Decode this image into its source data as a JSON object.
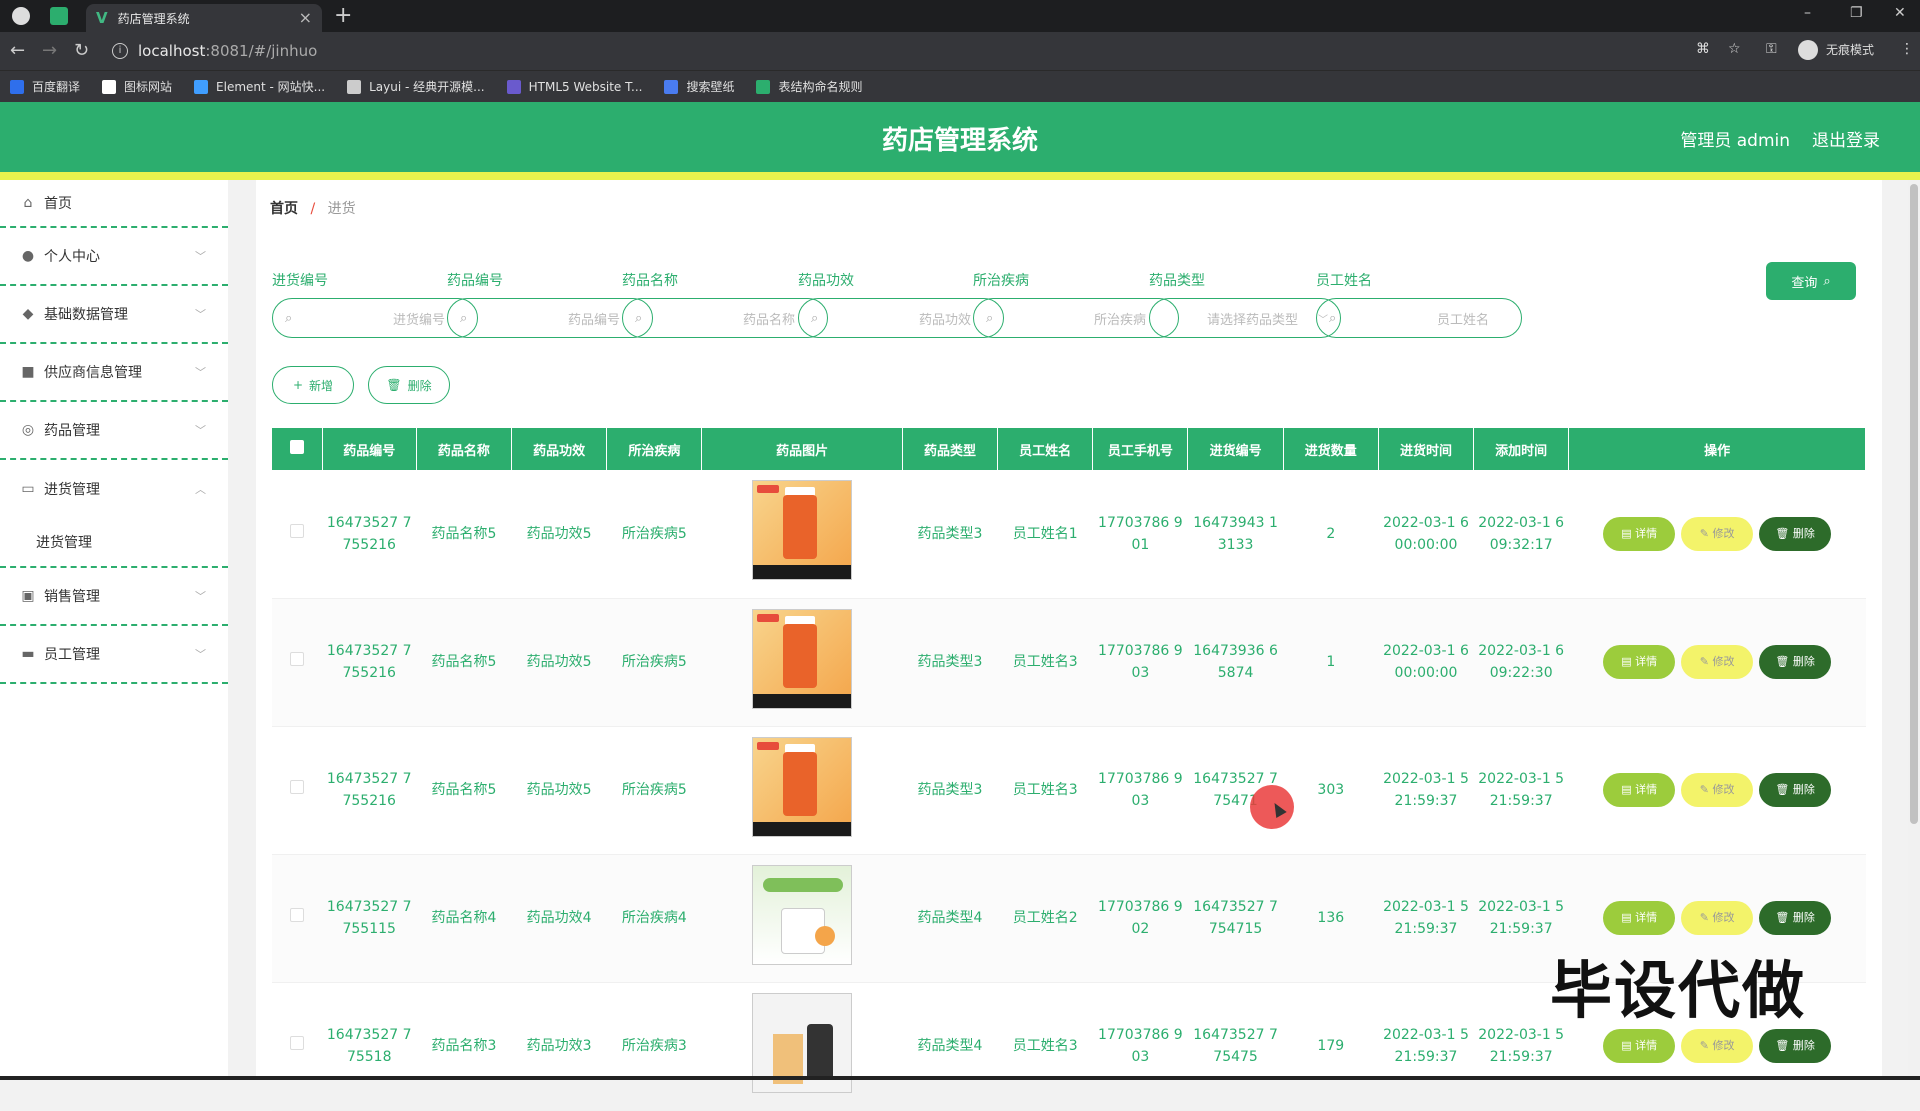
{
  "browser": {
    "tab_title": "药店管理系统",
    "url_host": "localhost",
    "url_rest": ":8081/#/jinhuo",
    "incognito_label": "无痕模式",
    "bookmarks": [
      {
        "label": "百度翻译",
        "color": "#2f6fec"
      },
      {
        "label": "图标网站",
        "color": "#ffffff"
      },
      {
        "label": "Element - 网站快...",
        "color": "#409eff"
      },
      {
        "label": "Layui - 经典开源模...",
        "color": "#cccccc"
      },
      {
        "label": "HTML5 Website T...",
        "color": "#6a5acd"
      },
      {
        "label": "搜索壁纸",
        "color": "#4a7cf0"
      },
      {
        "label": "表结构命名规则",
        "color": "#2cae6e"
      }
    ]
  },
  "header": {
    "title": "药店管理系统",
    "user": "管理员 admin",
    "logout": "退出登录"
  },
  "sidebar": {
    "items": [
      {
        "label": "首页",
        "icon": "home-icon"
      },
      {
        "label": "个人中心",
        "icon": "user-icon"
      },
      {
        "label": "基础数据管理",
        "icon": "data-icon"
      },
      {
        "label": "供应商信息管理",
        "icon": "supplier-icon"
      },
      {
        "label": "药品管理",
        "icon": "medicine-icon"
      },
      {
        "label": "进货管理",
        "icon": "purchase-icon"
      },
      {
        "label": "进货管理",
        "icon": ""
      },
      {
        "label": "销售管理",
        "icon": "sales-icon"
      },
      {
        "label": "员工管理",
        "icon": "staff-icon"
      }
    ]
  },
  "breadcrumb": {
    "home": "首页",
    "sep": "/",
    "current": "进货"
  },
  "filters": [
    {
      "label": "进货编号",
      "placeholder": "进货编号"
    },
    {
      "label": "药品编号",
      "placeholder": "药品编号"
    },
    {
      "label": "药品名称",
      "placeholder": "药品名称"
    },
    {
      "label": "药品功效",
      "placeholder": "药品功效"
    },
    {
      "label": "所治疾病",
      "placeholder": "所治疾病"
    },
    {
      "label": "药品类型",
      "placeholder": "请选择药品类型"
    },
    {
      "label": "员工姓名",
      "placeholder": "员工姓名"
    }
  ],
  "buttons": {
    "query": "查询",
    "add": "新增",
    "delete": "删除"
  },
  "table": {
    "headers": [
      "药品编号",
      "药品名称",
      "药品功效",
      "所治疾病",
      "药品图片",
      "药品类型",
      "员工姓名",
      "员工手机号",
      "进货编号",
      "进货数量",
      "进货时间",
      "添加时间",
      "操作"
    ],
    "actions": {
      "detail": "详情",
      "edit": "修改",
      "delete": "删除"
    },
    "rows": [
      {
        "code": "16473527 7755216",
        "name": "药品名称5",
        "effect": "药品功效5",
        "disease": "所治疾病5",
        "img": "orange",
        "type": "药品类型3",
        "staff": "员工姓名1",
        "phone": "17703786 901",
        "pno": "16473943 13133",
        "qty": "2",
        "ptime": "2022-03-1 6 00:00:00",
        "atime": "2022-03-1 6 09:32:17"
      },
      {
        "code": "16473527 7755216",
        "name": "药品名称5",
        "effect": "药品功效5",
        "disease": "所治疾病5",
        "img": "orange",
        "type": "药品类型3",
        "staff": "员工姓名3",
        "phone": "17703786 903",
        "pno": "16473936 65874",
        "qty": "1",
        "ptime": "2022-03-1 6 00:00:00",
        "atime": "2022-03-1 6 09:22:30"
      },
      {
        "code": "16473527 7755216",
        "name": "药品名称5",
        "effect": "药品功效5",
        "disease": "所治疾病5",
        "img": "orange",
        "type": "药品类型3",
        "staff": "员工姓名3",
        "phone": "17703786 903",
        "pno": "16473527 775471",
        "qty": "303",
        "ptime": "2022-03-1 5 21:59:37",
        "atime": "2022-03-1 5 21:59:37"
      },
      {
        "code": "16473527 7755115",
        "name": "药品名称4",
        "effect": "药品功效4",
        "disease": "所治疾病4",
        "img": "green",
        "type": "药品类型4",
        "staff": "员工姓名2",
        "phone": "17703786 902",
        "pno": "16473527 7754715",
        "qty": "136",
        "ptime": "2022-03-1 5 21:59:37",
        "atime": "2022-03-1 5 21:59:37"
      },
      {
        "code": "16473527 775518",
        "name": "药品名称3",
        "effect": "药品功效3",
        "disease": "所治疾病3",
        "img": "box",
        "type": "药品类型4",
        "staff": "员工姓名3",
        "phone": "17703786 903",
        "pno": "16473527 775475",
        "qty": "179",
        "ptime": "2022-03-1 5 21:59:37",
        "atime": "2022-03-1 5 21:59:37"
      }
    ]
  },
  "watermark": "毕设代做",
  "colors": {
    "primary": "#2cae6e",
    "accent": "#e8f34d",
    "detail": "#9ccc3c",
    "edit": "#f3f36a",
    "delete": "#2d6b2a"
  }
}
